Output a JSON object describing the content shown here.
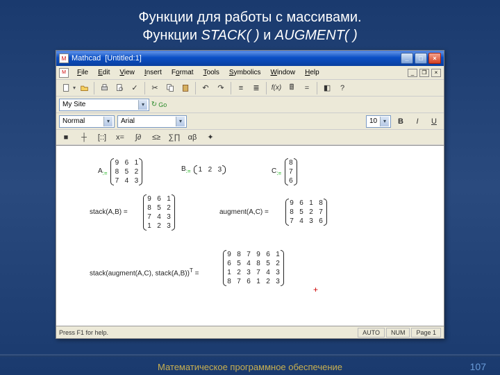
{
  "slide": {
    "title_l1": "Функции для работы с массивами.",
    "title_l2a": "Функции ",
    "title_fn1": "STACK( )",
    "title_l2b": " и ",
    "title_fn2": "AUGMENT( )"
  },
  "window": {
    "app": "Mathcad",
    "doc": "[Untitled:1]",
    "min": "_",
    "max": "□",
    "close": "×"
  },
  "menu": {
    "file": "File",
    "edit": "Edit",
    "view": "View",
    "insert": "Insert",
    "format": "Format",
    "tools": "Tools",
    "symbolics": "Symbolics",
    "window": "Window",
    "help": "Help"
  },
  "tb1": {
    "new": "new",
    "open": "open",
    "save": "save",
    "print": "print",
    "preview": "preview",
    "cut": "cut",
    "copy": "copy",
    "paste": "paste",
    "undo": "undo",
    "redo": "redo",
    "fx": "f(x)",
    "eq": "=",
    "help": "?"
  },
  "row2": {
    "site": "My Site",
    "go": "Go"
  },
  "row3": {
    "style": "Normal",
    "font": "Arial",
    "size": "10",
    "bold": "B",
    "italic": "I",
    "under": "U"
  },
  "row4": {
    "items": [
      "■",
      "┼",
      "[::]",
      "x=",
      "∫∂",
      "≤≥",
      "∑∏",
      "αβ",
      "✦"
    ]
  },
  "math": {
    "A_lbl": "A",
    "A_sub": ":=",
    "A": [
      [
        "9",
        "6",
        "1"
      ],
      [
        "8",
        "5",
        "2"
      ],
      [
        "7",
        "4",
        "3"
      ]
    ],
    "B_lbl": "B",
    "B_sub": ":=",
    "B": [
      [
        "1",
        "2",
        "3"
      ]
    ],
    "C_lbl": "C",
    "C_sub": ":=",
    "C": [
      [
        "8"
      ],
      [
        "7"
      ],
      [
        "6"
      ]
    ],
    "stack_lbl": "stack(A,B) =",
    "stack_res": [
      [
        "9",
        "6",
        "1"
      ],
      [
        "8",
        "5",
        "2"
      ],
      [
        "7",
        "4",
        "3"
      ],
      [
        "1",
        "2",
        "3"
      ]
    ],
    "aug_lbl": "augment(A,C) =",
    "aug_res": [
      [
        "9",
        "6",
        "1",
        "8"
      ],
      [
        "8",
        "5",
        "2",
        "7"
      ],
      [
        "7",
        "4",
        "3",
        "6"
      ]
    ],
    "big_lbl_a": "stack",
    "big_lbl_b": "augment(A,C), stack(A,B)",
    "big_T": "T",
    "big_eq": " =",
    "big_res": [
      [
        "9",
        "8",
        "7",
        "9",
        "6",
        "1"
      ],
      [
        "6",
        "5",
        "4",
        "8",
        "5",
        "2"
      ],
      [
        "1",
        "2",
        "3",
        "7",
        "4",
        "3"
      ],
      [
        "8",
        "7",
        "6",
        "1",
        "2",
        "3"
      ]
    ],
    "plus": "+"
  },
  "status": {
    "help": "Press F1 for help.",
    "auto": "AUTO",
    "num": "NUM",
    "page": "Page 1"
  },
  "footer": {
    "text": "Математическое программное обеспечение",
    "page": "107"
  }
}
